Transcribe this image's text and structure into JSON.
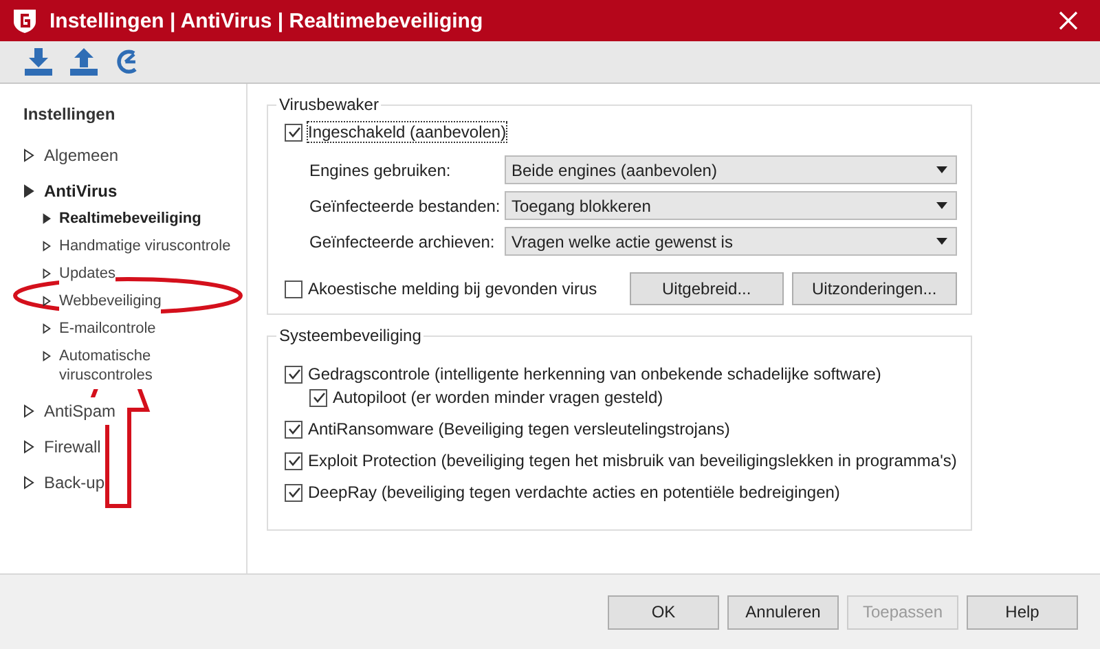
{
  "window": {
    "title": "Instellingen | AntiVirus | Realtimebeveiliging"
  },
  "toolbar": {
    "buttons": [
      {
        "kind": "import"
      },
      {
        "kind": "export"
      },
      {
        "kind": "reset"
      }
    ]
  },
  "sidebar": {
    "title": "Instellingen",
    "items": [
      {
        "label": "Algemeen",
        "expanded": false
      },
      {
        "label": "AntiVirus",
        "expanded": true,
        "children": [
          {
            "label": "Realtimebeveiliging",
            "selected": true
          },
          {
            "label": "Handmatige viruscontrole",
            "selected": false
          },
          {
            "label": "Updates",
            "selected": false
          },
          {
            "label": "Webbeveiliging",
            "selected": false
          },
          {
            "label": "E-mailcontrole",
            "selected": false
          },
          {
            "label": "Automatische viruscontroles",
            "selected": false
          }
        ]
      },
      {
        "label": "AntiSpam",
        "expanded": false
      },
      {
        "label": "Firewall",
        "expanded": false
      },
      {
        "label": "Back-up",
        "expanded": false
      }
    ]
  },
  "virusbewaker": {
    "title": "Virusbewaker",
    "enabled": {
      "label": "Ingeschakeld (aanbevolen)",
      "checked": true
    },
    "dropdowns": [
      {
        "label": "Engines gebruiken:",
        "value": "Beide engines (aanbevolen)"
      },
      {
        "label": "Geïnfecteerde bestanden:",
        "value": "Toegang blokkeren"
      },
      {
        "label": "Geïnfecteerde archieven:",
        "value": "Vragen welke actie gewenst is"
      }
    ],
    "sound": {
      "label": "Akoestische melding bij gevonden virus",
      "checked": false
    },
    "buttons": [
      "Uitgebreid...",
      "Uitzonderingen..."
    ]
  },
  "systeembeveiliging": {
    "title": "Systeembeveiliging",
    "options": [
      {
        "label": "Gedragscontrole (intelligente herkenning van onbekende schadelijke software)",
        "checked": true,
        "children": [
          {
            "label": "Autopiloot (er worden minder vragen gesteld)",
            "checked": true
          }
        ]
      },
      {
        "label": "AntiRansomware (Beveiliging tegen versleutelingstrojans)",
        "checked": true
      },
      {
        "label": "Exploit Protection (beveiliging tegen het misbruik van beveiligingslekken in programma's)",
        "checked": true
      },
      {
        "label": "DeepRay (beveiliging tegen verdachte acties en potentiële bedreigingen)",
        "checked": true
      }
    ]
  },
  "footer": {
    "buttons": [
      {
        "label": "OK",
        "disabled": false
      },
      {
        "label": "Annuleren",
        "disabled": false
      },
      {
        "label": "Toepassen",
        "disabled": true
      },
      {
        "label": "Help",
        "disabled": false
      }
    ]
  }
}
